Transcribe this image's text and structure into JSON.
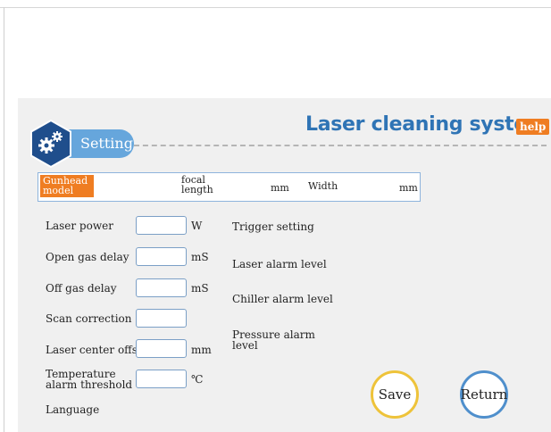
{
  "header": {
    "title": "Laser cleaning system",
    "help_label": "help",
    "setting_label": "Setting"
  },
  "gunhead": {
    "model_label": "Gunhead model",
    "focal_label": "focal length",
    "focal_unit": "mm",
    "width_label": "Width",
    "width_unit": "mm"
  },
  "params": [
    {
      "label": "Laser power",
      "unit": "W",
      "value": ""
    },
    {
      "label": "Open gas delay",
      "unit": "mS",
      "value": ""
    },
    {
      "label": "Off gas delay",
      "unit": "mS",
      "value": ""
    },
    {
      "label": "Scan correction",
      "unit": "",
      "value": ""
    },
    {
      "label": "Laser center offset",
      "unit": "mm",
      "value": ""
    },
    {
      "label": "Temperature alarm threshold",
      "unit": "℃",
      "value": ""
    }
  ],
  "language_label": "Language",
  "right": {
    "trigger": "Trigger setting",
    "laser_alarm": "Laser alarm level",
    "chiller_alarm": "Chiller alarm level",
    "pressure_alarm": "Pressure alarm level"
  },
  "buttons": {
    "save": "Save",
    "return": "Return"
  },
  "colors": {
    "accent_blue": "#2f74b5",
    "orange": "#ef7d22",
    "save_ring": "#eec33a",
    "return_ring": "#4f8fcc"
  }
}
